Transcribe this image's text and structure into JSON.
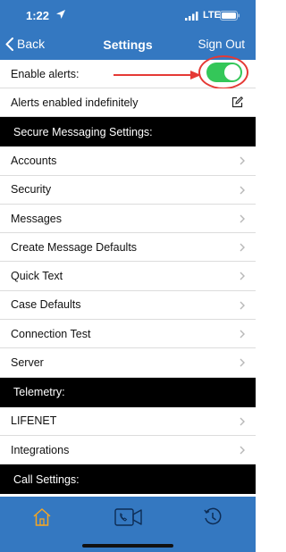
{
  "status_bar": {
    "time": "1:22",
    "network": "LTE"
  },
  "nav": {
    "back_label": "Back",
    "title": "Settings",
    "sign_out_label": "Sign Out"
  },
  "alerts": {
    "enable_label": "Enable alerts:",
    "enabled": true,
    "status_text": "Alerts enabled indefinitely"
  },
  "sections": {
    "secure_messaging": {
      "header": "Secure Messaging Settings:",
      "items": [
        "Accounts",
        "Security",
        "Messages",
        "Create Message Defaults",
        "Quick Text",
        "Case Defaults",
        "Connection Test",
        "Server"
      ]
    },
    "telemetry": {
      "header": "Telemetry:",
      "items": [
        "LIFENET",
        "Integrations"
      ]
    },
    "call": {
      "header": "Call Settings:"
    }
  },
  "tabs": [
    {
      "icon": "home-icon",
      "active": true
    },
    {
      "icon": "video-call-icon",
      "active": false
    },
    {
      "icon": "history-icon",
      "active": false
    }
  ],
  "colors": {
    "brand_blue": "#3478c1",
    "toggle_green": "#34c759",
    "annotation_red": "#e53935",
    "active_tab": "#f5a623"
  }
}
